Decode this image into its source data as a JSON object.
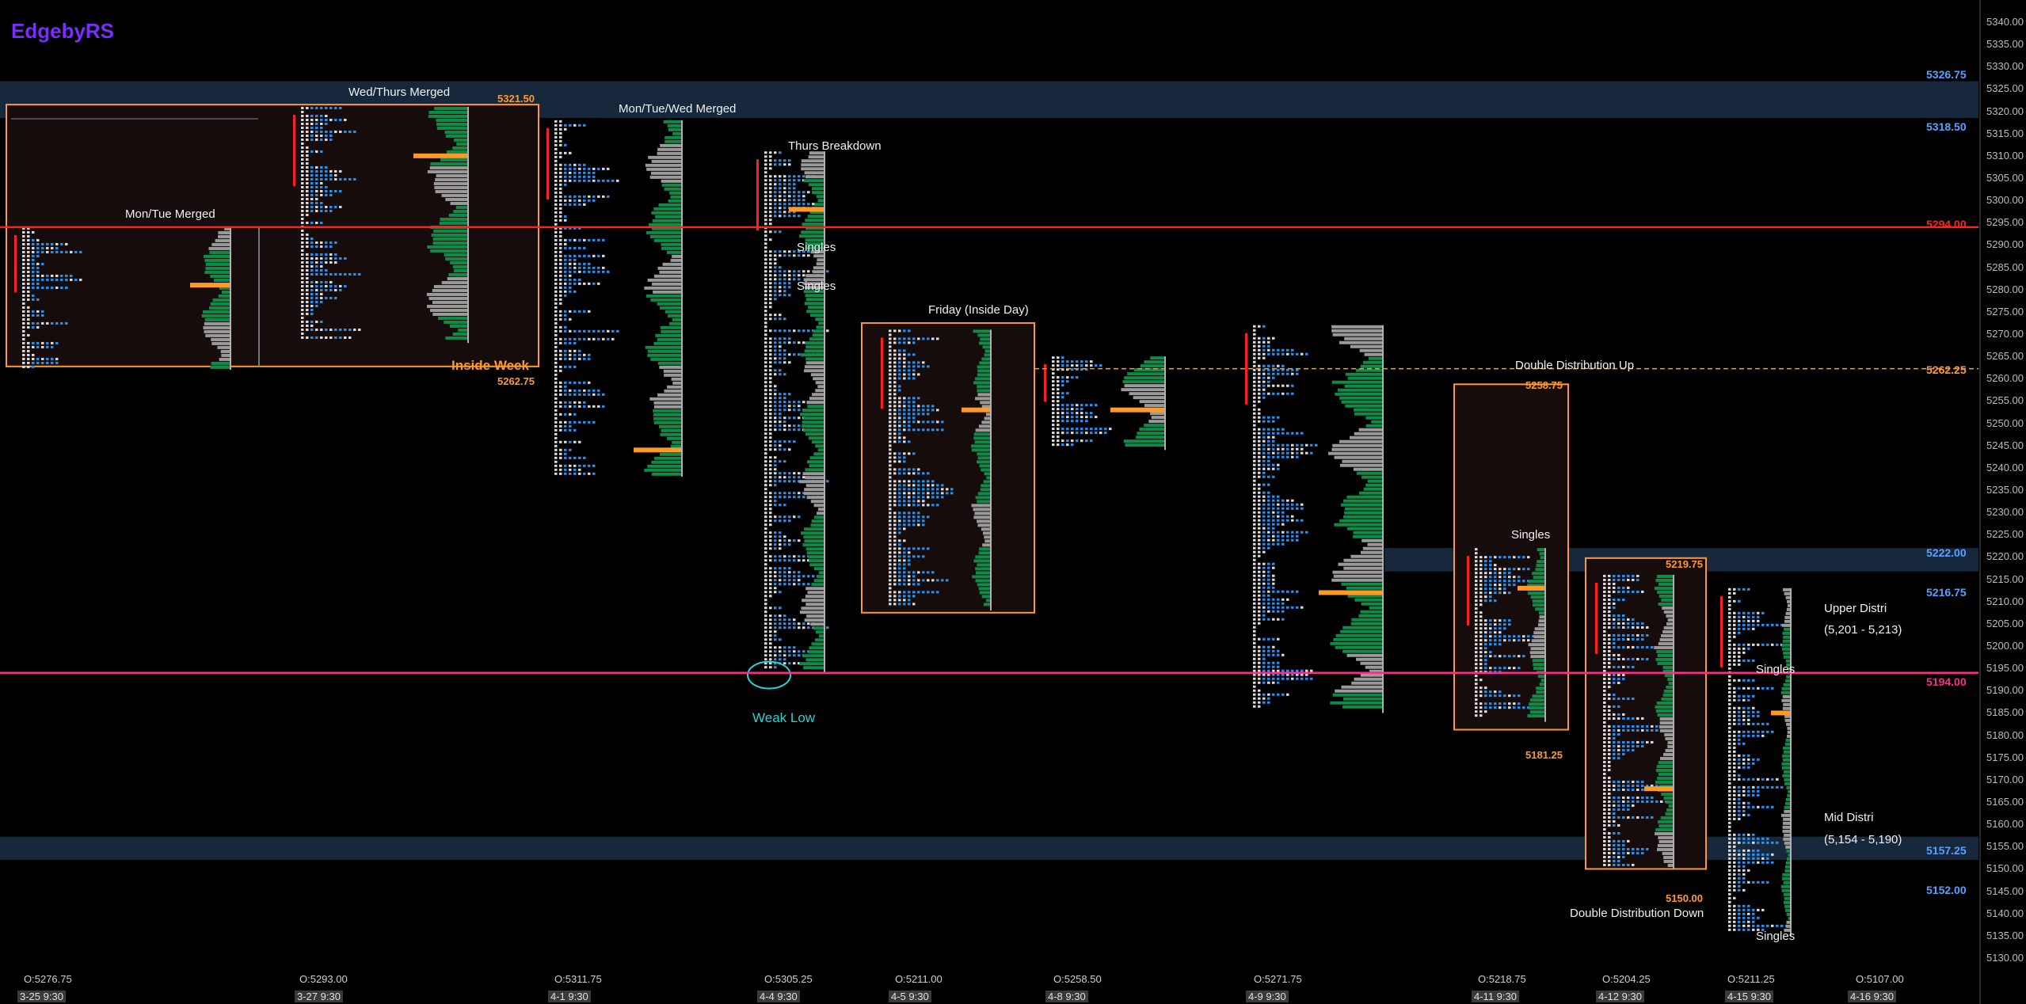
{
  "brand": "EdgebyRS",
  "colors": {
    "background": "#000000",
    "brand": "#7b2cff",
    "red_level": "#ff2020",
    "pink_level": "#ff2a8a",
    "blue_level": "#5aa0ff",
    "orange_box": "#ff9a2a",
    "profile_green": "#0f8a48",
    "profile_gray": "#9a9a9a",
    "tpo_blue": "#2e8fe6",
    "weak_low": "#22d6d6",
    "band": "#17283c"
  },
  "price_axis": {
    "min": 5130,
    "max": 5340,
    "ticks": [
      "5340.00",
      "5335.00",
      "5330.00",
      "5325.00",
      "5320.00",
      "5315.00",
      "5310.00",
      "5305.00",
      "5300.00",
      "5295.00",
      "5290.00",
      "5285.00",
      "5280.00",
      "5275.00",
      "5270.00",
      "5265.00",
      "5260.00",
      "5255.00",
      "5250.00",
      "5245.00",
      "5240.00",
      "5235.00",
      "5230.00",
      "5225.00",
      "5220.00",
      "5215.00",
      "5210.00",
      "5205.00",
      "5200.00",
      "5195.00",
      "5190.00",
      "5185.00",
      "5180.00",
      "5175.00",
      "5170.00",
      "5165.00",
      "5160.00",
      "5155.00",
      "5150.00",
      "5145.00",
      "5140.00",
      "5135.00",
      "5130.00"
    ]
  },
  "levels": [
    {
      "label": "5326.75",
      "price": 5326.75,
      "color": "#5aa0ff"
    },
    {
      "label": "5318.50",
      "price": 5318.5,
      "color": "#5aa0ff"
    },
    {
      "label": "5294.00",
      "price": 5294.0,
      "color": "#ff2020"
    },
    {
      "label": "5262.25",
      "price": 5262.25,
      "color": "#ff9a2a"
    },
    {
      "label": "5222.00",
      "price": 5222.0,
      "color": "#5aa0ff"
    },
    {
      "label": "5216.75",
      "price": 5216.75,
      "color": "#5aa0ff"
    },
    {
      "label": "5194.00",
      "price": 5194.0,
      "color": "#ff2a8a"
    },
    {
      "label": "5157.25",
      "price": 5157.25,
      "color": "#5aa0ff"
    },
    {
      "label": "5152.00",
      "price": 5152.0,
      "color": "#5aa0ff"
    }
  ],
  "annotations": {
    "wed_thurs_merged": "Wed/Thurs Merged",
    "mon_tue_wed_merged": "Mon/Tue/Wed Merged",
    "mon_tue_merged": "Mon/Tue Merged",
    "thurs_breakdown": "Thurs Breakdown",
    "singles_1": "Singles",
    "singles_2": "Singles",
    "friday_inside_day": "Friday (Inside Day)",
    "double_distribution_up": "Double Distribution Up",
    "singles_3": "Singles",
    "singles_4": "Singles",
    "singles_5": "Singles",
    "upper_distri": "Upper Distri",
    "upper_distri_range": "(5,201 - 5,213)",
    "mid_distri": "Mid Distri",
    "mid_distri_range": "(5,154 - 5,190)",
    "double_distribution_down": "Double Distribution Down",
    "inside_week": "Inside Week",
    "weak_low": "Weak Low"
  },
  "box_labels": {
    "week_high": "5321.50",
    "week_low": "5262.75",
    "dd_up_high": "5258.75",
    "dd_up_low": "5181.25",
    "dd_down_high": "5219.75",
    "dd_down_low": "5150.00"
  },
  "sessions": [
    {
      "open": "O:5276.75",
      "date": "3-25  9:30"
    },
    {
      "open": "O:5293.00",
      "date": "3-27  9:30"
    },
    {
      "open": "O:5311.75",
      "date": "4-1  9:30"
    },
    {
      "open": "O:5305.25",
      "date": "4-4  9:30"
    },
    {
      "open": "O:5211.00",
      "date": "4-5  9:30"
    },
    {
      "open": "O:5258.50",
      "date": "4-8  9:30"
    },
    {
      "open": "O:5271.75",
      "date": "4-9  9:30"
    },
    {
      "open": "O:5218.75",
      "date": "4-11  9:30"
    },
    {
      "open": "O:5204.25",
      "date": "4-12  9:30"
    },
    {
      "open": "O:5211.25",
      "date": "4-15  9:30"
    },
    {
      "open": "O:5107.00",
      "date": "4-16  9:30"
    }
  ]
}
